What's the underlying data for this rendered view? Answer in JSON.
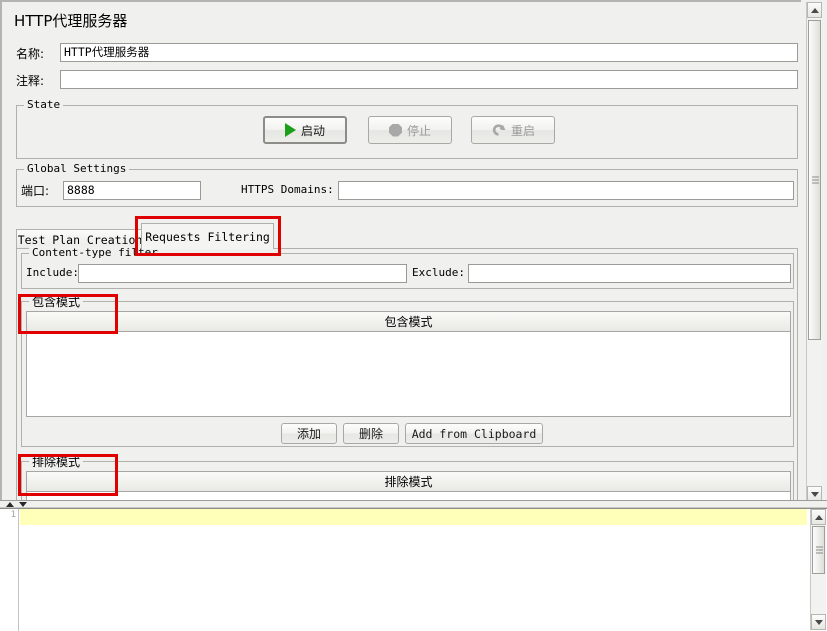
{
  "window": {
    "title": "HTTP代理服务器"
  },
  "form": {
    "name_label": "名称:",
    "name_value": "HTTP代理服务器",
    "comment_label": "注释:",
    "comment_value": ""
  },
  "state_group": {
    "title": "State",
    "buttons": [
      {
        "label": "启动",
        "icon": "play-icon",
        "enabled": true
      },
      {
        "label": "停止",
        "icon": "stop-icon",
        "enabled": false
      },
      {
        "label": "重启",
        "icon": "restart-icon",
        "enabled": false
      }
    ]
  },
  "global_settings": {
    "title": "Global Settings",
    "port_label": "端口:",
    "port_value": "8888",
    "https_domains_label": "HTTPS Domains:",
    "https_domains_value": ""
  },
  "tabs": [
    {
      "label": "Test Plan Creation",
      "selected": false
    },
    {
      "label": "Requests Filtering",
      "selected": true
    }
  ],
  "content_type_filter": {
    "title": "Content-type filter",
    "include_label": "Include:",
    "include_value": "",
    "exclude_label": "Exclude:",
    "exclude_value": ""
  },
  "include_patterns": {
    "title": "包含模式",
    "column_header": "包含模式",
    "rows": [],
    "buttons": [
      {
        "label": "添加"
      },
      {
        "label": "删除"
      },
      {
        "label": "Add from Clipboard"
      }
    ]
  },
  "exclude_patterns": {
    "title": "排除模式",
    "column_header": "排除模式",
    "rows": []
  },
  "editor": {
    "line_numbers": [
      "1"
    ],
    "lines": [
      ""
    ]
  },
  "colors": {
    "annotation": "#e00000",
    "start_icon": "#1aa01a",
    "current_line": "#ffffb9",
    "panel_bg": "#f0f0ee"
  }
}
